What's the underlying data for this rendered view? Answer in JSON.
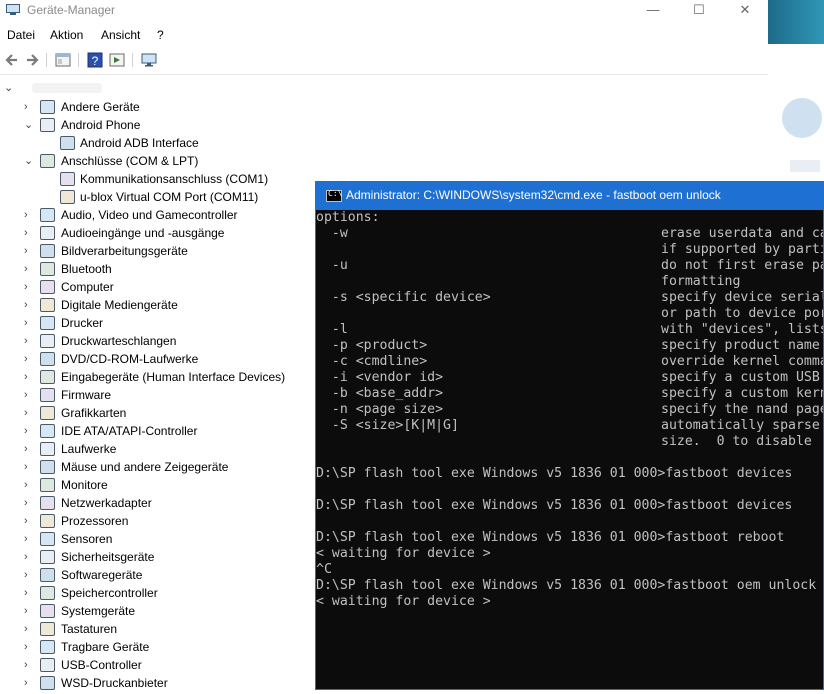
{
  "device_manager": {
    "title": "Geräte-Manager",
    "window_buttons": {
      "minimize": "—",
      "maximize": "☐",
      "close": "✕"
    },
    "menu": [
      "Datei",
      "Aktion",
      "Ansicht",
      "?"
    ],
    "toolbar_icons": [
      "back-icon",
      "forward-icon",
      "properties-icon",
      "help-icon",
      "show-hidden-icon",
      "monitor-icon"
    ],
    "tree": [
      {
        "label": "Andere Geräte",
        "level": 1,
        "state": "collapsed"
      },
      {
        "label": "Android Phone",
        "level": 1,
        "state": "expanded"
      },
      {
        "label": "Android ADB Interface",
        "level": 2,
        "state": "leaf"
      },
      {
        "label": "Anschlüsse (COM & LPT)",
        "level": 1,
        "state": "expanded"
      },
      {
        "label": "Kommunikationsanschluss (COM1)",
        "level": 2,
        "state": "leaf"
      },
      {
        "label": "u-blox Virtual COM Port (COM11)",
        "level": 2,
        "state": "leaf"
      },
      {
        "label": "Audio, Video und Gamecontroller",
        "level": 1,
        "state": "collapsed"
      },
      {
        "label": "Audioeingänge und -ausgänge",
        "level": 1,
        "state": "collapsed"
      },
      {
        "label": "Bildverarbeitungsgeräte",
        "level": 1,
        "state": "collapsed"
      },
      {
        "label": "Bluetooth",
        "level": 1,
        "state": "collapsed"
      },
      {
        "label": "Computer",
        "level": 1,
        "state": "collapsed"
      },
      {
        "label": "Digitale Mediengeräte",
        "level": 1,
        "state": "collapsed"
      },
      {
        "label": "Drucker",
        "level": 1,
        "state": "collapsed"
      },
      {
        "label": "Druckwarteschlangen",
        "level": 1,
        "state": "collapsed"
      },
      {
        "label": "DVD/CD-ROM-Laufwerke",
        "level": 1,
        "state": "collapsed"
      },
      {
        "label": "Eingabegeräte (Human Interface Devices)",
        "level": 1,
        "state": "collapsed"
      },
      {
        "label": "Firmware",
        "level": 1,
        "state": "collapsed"
      },
      {
        "label": "Grafikkarten",
        "level": 1,
        "state": "collapsed"
      },
      {
        "label": "IDE ATA/ATAPI-Controller",
        "level": 1,
        "state": "collapsed"
      },
      {
        "label": "Laufwerke",
        "level": 1,
        "state": "collapsed"
      },
      {
        "label": "Mäuse und andere Zeigegeräte",
        "level": 1,
        "state": "collapsed"
      },
      {
        "label": "Monitore",
        "level": 1,
        "state": "collapsed"
      },
      {
        "label": "Netzwerkadapter",
        "level": 1,
        "state": "collapsed"
      },
      {
        "label": "Prozessoren",
        "level": 1,
        "state": "collapsed"
      },
      {
        "label": "Sensoren",
        "level": 1,
        "state": "collapsed"
      },
      {
        "label": "Sicherheitsgeräte",
        "level": 1,
        "state": "collapsed"
      },
      {
        "label": "Softwaregeräte",
        "level": 1,
        "state": "collapsed"
      },
      {
        "label": "Speichercontroller",
        "level": 1,
        "state": "collapsed"
      },
      {
        "label": "Systemgeräte",
        "level": 1,
        "state": "collapsed"
      },
      {
        "label": "Tastaturen",
        "level": 1,
        "state": "collapsed"
      },
      {
        "label": "Tragbare Geräte",
        "level": 1,
        "state": "collapsed"
      },
      {
        "label": "USB-Controller",
        "level": 1,
        "state": "collapsed"
      },
      {
        "label": "WSD-Druckanbieter",
        "level": 1,
        "state": "collapsed"
      }
    ]
  },
  "cmd": {
    "title": "Administrator: C:\\WINDOWS\\system32\\cmd.exe - fastboot  oem unlock",
    "icon_text": "C:\\",
    "lines": [
      {
        "left": "options:",
        "right": ""
      },
      {
        "left": "  -w",
        "right": "erase userdata and ca"
      },
      {
        "left": "",
        "right": "if supported by parti"
      },
      {
        "left": "  -u",
        "right": "do not first erase pa"
      },
      {
        "left": "",
        "right": "formatting"
      },
      {
        "left": "  -s <specific device>",
        "right": "specify device serial"
      },
      {
        "left": "",
        "right": "or path to device por"
      },
      {
        "left": "  -l",
        "right": "with \"devices\", lists"
      },
      {
        "left": "  -p <product>",
        "right": "specify product name"
      },
      {
        "left": "  -c <cmdline>",
        "right": "override kernel comma"
      },
      {
        "left": "  -i <vendor id>",
        "right": "specify a custom USB"
      },
      {
        "left": "  -b <base_addr>",
        "right": "specify a custom kern"
      },
      {
        "left": "  -n <page size>",
        "right": "specify the nand page"
      },
      {
        "left": "  -S <size>[K|M|G]",
        "right": "automatically sparse"
      },
      {
        "left": "",
        "right": "size.  0 to disable"
      },
      {
        "left": "",
        "right": ""
      },
      {
        "left": "D:\\SP flash tool exe Windows v5 1836 01 000>fastboot devices",
        "right": ""
      },
      {
        "left": "",
        "right": ""
      },
      {
        "left": "D:\\SP flash tool exe Windows v5 1836 01 000>fastboot devices",
        "right": ""
      },
      {
        "left": "",
        "right": ""
      },
      {
        "left": "D:\\SP flash tool exe Windows v5 1836 01 000>fastboot reboot",
        "right": ""
      },
      {
        "left": "< waiting for device >",
        "right": ""
      },
      {
        "left": "^C",
        "right": ""
      },
      {
        "left": "D:\\SP flash tool exe Windows v5 1836 01 000>fastboot oem unlock",
        "right": ""
      },
      {
        "left": "< waiting for device >",
        "right": ""
      }
    ]
  },
  "colors": {
    "cmd_titlebar": "#1e70d2",
    "cmd_background": "#0c0c0c",
    "cmd_text": "#c0c0c0"
  }
}
